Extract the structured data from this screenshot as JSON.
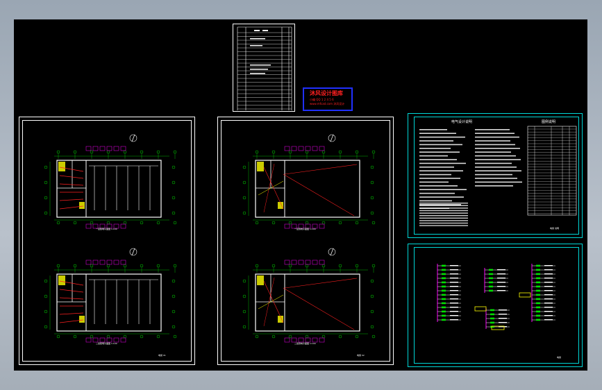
{
  "colors": {
    "background": "#000000",
    "frame": "#ffffff",
    "cyan": "#00d8d8",
    "green": "#00e000",
    "magenta": "#d000d0",
    "red": "#ff2020",
    "yellow": "#ffff00",
    "blue": "#2030ff"
  },
  "stamp": {
    "title": "沐风设计图库",
    "line2": "小编 QQ 1 2 4 5 6",
    "line3": "www.mfcad.com 沐风设计"
  },
  "notes_sheet": {
    "title": "电气设计说明",
    "table_title": "图例说明",
    "footer": "电施  说明"
  },
  "riser_sheet": {
    "footer": "电施"
  },
  "plans": {
    "left_scale_top": "一层照明平面图  1:100",
    "left_scale_bottom": "二层照明平面图  1:100",
    "right_scale_top": "一层弱电平面图  1:100",
    "right_scale_bottom": "二层弱电平面图  1:100",
    "left_titleblock": "电施 01",
    "right_titleblock": "电施 02"
  }
}
